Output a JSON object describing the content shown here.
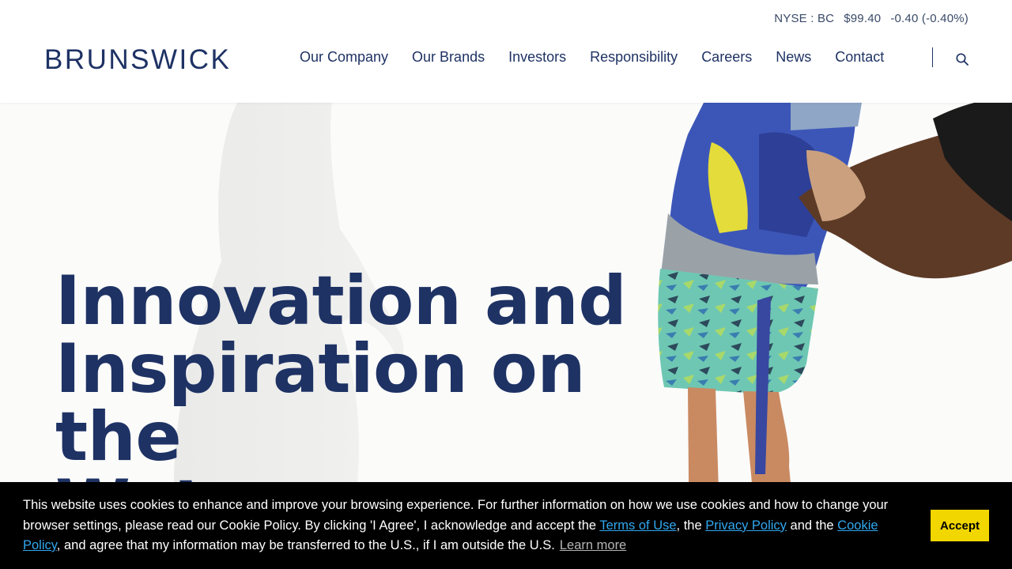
{
  "ticker": {
    "exchange": "NYSE : BC",
    "price": "$99.40",
    "change": "-0.40 (-0.40%)"
  },
  "brand": {
    "logo_text": "BRUNSWICK",
    "color": "#1e3264"
  },
  "nav": {
    "items": [
      {
        "label": "Our Company"
      },
      {
        "label": "Our Brands"
      },
      {
        "label": "Investors"
      },
      {
        "label": "Responsibility"
      },
      {
        "label": "Careers"
      },
      {
        "label": "News"
      },
      {
        "label": "Contact"
      }
    ],
    "search_icon": "search-icon"
  },
  "hero": {
    "title_lines": [
      "Innovation and",
      "Inspiration on the",
      "Water"
    ]
  },
  "cookie": {
    "text_1": "This website uses cookies to enhance and improve your browsing experience. For further information on how we use cookies and how to change your browser settings, please read our Cookie Policy. By clicking 'I Agree', I acknowledge and accept the ",
    "terms_link": "Terms of Use",
    "text_2": ", the ",
    "privacy_link": "Privacy Policy",
    "text_3": " and the ",
    "cookie_link": "Cookie Policy",
    "text_4": ", and agree that my information may be transferred to the U.S., if I am outside the U.S.",
    "learn_more": "Learn more",
    "accept_label": "Accept",
    "accept_color": "#f1d600",
    "link_color": "#31a8f0"
  }
}
